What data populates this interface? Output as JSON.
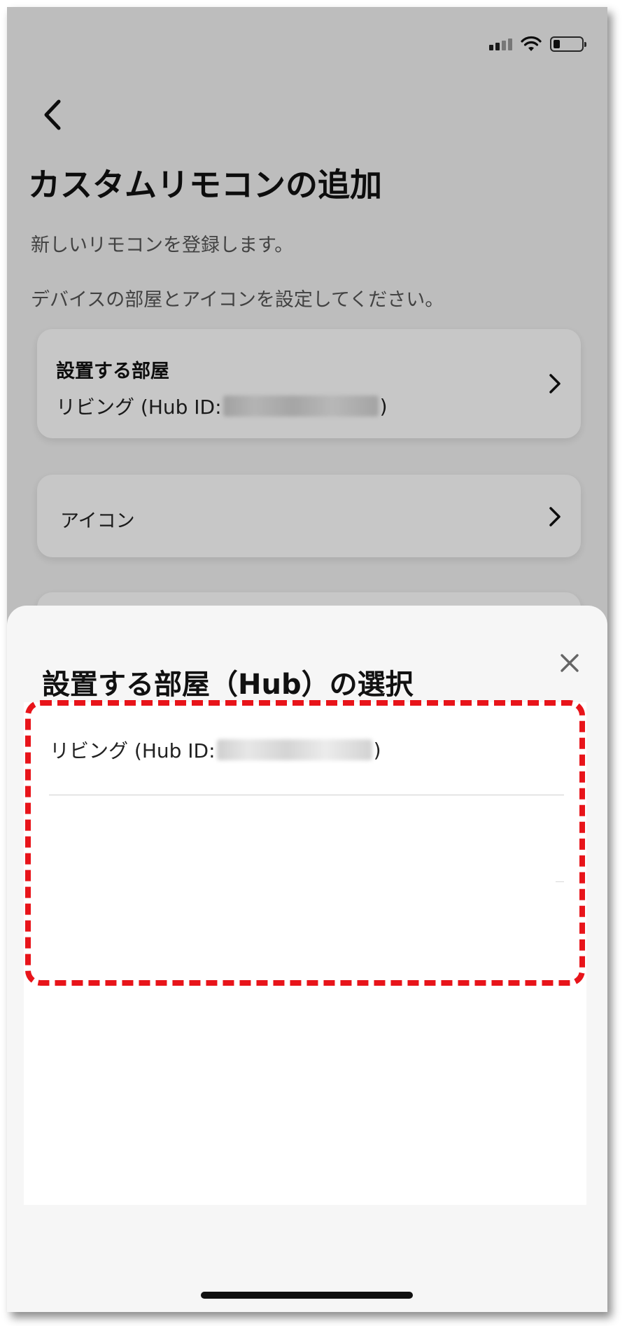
{
  "page": {
    "back_icon": "chevron-left-icon",
    "title": "カスタムリモコンの追加",
    "description_line1": "新しいリモコンを登録します。",
    "description_line2": "デバイスの部屋とアイコンを設定してください。"
  },
  "room_card": {
    "label": "設置する部屋",
    "value_prefix": "リビング (Hub ID:",
    "value_suffix": ")"
  },
  "icon_card": {
    "label": "アイコン"
  },
  "sheet": {
    "title": "設置する部屋（Hub）の選択",
    "close_icon": "close-icon",
    "items": [
      {
        "prefix": "リビング (Hub ID:",
        "suffix": ")"
      }
    ]
  },
  "colors": {
    "highlight": "#e8141a",
    "overlay": "rgba(0,0,0,0.22)",
    "sheet_background": "#f6f6f6"
  }
}
